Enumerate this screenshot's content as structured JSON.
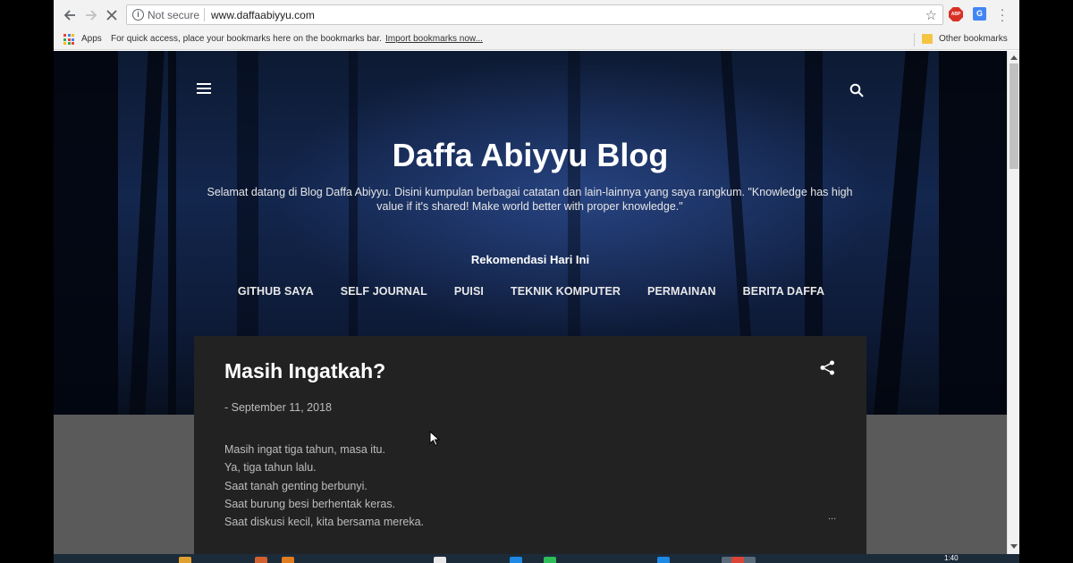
{
  "browser": {
    "security_text": "Not secure",
    "url": "www.daffaabiyyu.com",
    "abp_label": "ABP",
    "translate_label": "G"
  },
  "bookmarks_bar": {
    "apps_label": "Apps",
    "hint": "For quick access, place your bookmarks here on the bookmarks bar.",
    "import_label": "Import bookmarks now...",
    "other_label": "Other bookmarks"
  },
  "blog": {
    "title": "Daffa Abiyyu Blog",
    "description": "Selamat datang di Blog Daffa Abiyyu. Disini kumpulan berbagai catatan dan lain-lainnya yang saya rangkum. \"Knowledge has high value if it's shared! Make world better with proper knowledge.\"",
    "recommendation_heading": "Rekomendasi Hari Ini",
    "menu": [
      "GITHUB SAYA",
      "SELF JOURNAL",
      "PUISI",
      "TEKNIK KOMPUTER",
      "PERMAINAN",
      "BERITA DAFFA"
    ]
  },
  "post": {
    "title": "Masih Ingatkah?",
    "date": "- September 11, 2018",
    "lines": [
      "Masih ingat tiga tahun, masa itu.",
      "Ya, tiga tahun lalu.",
      "Saat tanah genting berbunyi.",
      "Saat burung besi berhentak keras.",
      "Saat diskusi kecil, kita bersama mereka."
    ],
    "more": "..."
  },
  "taskbar": {
    "time": "1:40"
  },
  "colors": {
    "card_bg": "#222222",
    "page_bg": "#5a5a5a",
    "hero_blue": "#13264d"
  }
}
